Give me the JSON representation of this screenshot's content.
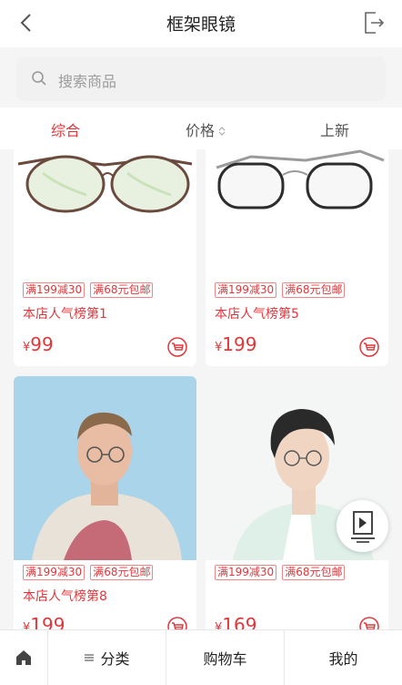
{
  "header": {
    "title": "框架眼镜",
    "back_icon": "chevron-left-icon",
    "exit_icon": "exit-icon"
  },
  "search": {
    "placeholder": "搜索商品",
    "icon": "search-icon"
  },
  "sort": {
    "items": [
      "综合",
      "价格",
      "上新"
    ],
    "active_color": "#e0373b"
  },
  "products": [
    {
      "tags": [
        "满199减30",
        "满68元包邮"
      ],
      "name": "本店人气榜第1",
      "currency": "¥",
      "price": "99"
    },
    {
      "tags": [
        "满199减30",
        "满68元包邮"
      ],
      "name": "本店人气榜第5",
      "currency": "¥",
      "price": "199"
    },
    {
      "tags": [
        "满199减30",
        "满68元包邮"
      ],
      "name": "本店人气榜第8",
      "currency": "¥",
      "price": "199"
    },
    {
      "tags": [
        "满199减30",
        "满68元包邮"
      ],
      "name": "",
      "currency": "¥",
      "price": "169"
    }
  ],
  "tabbar": {
    "home_icon": "home-icon",
    "category": "分类",
    "cart": "购物车",
    "mine": "我的"
  }
}
